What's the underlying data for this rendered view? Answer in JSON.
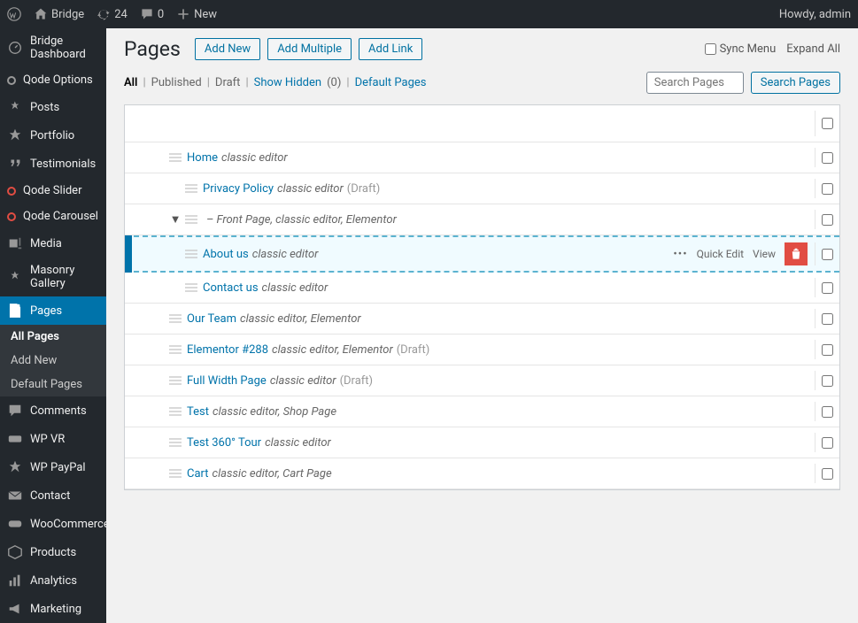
{
  "adminbar": {
    "site": "Bridge",
    "updates": "24",
    "comments": "0",
    "new": "New",
    "howdy": "Howdy, admin"
  },
  "sidebar": {
    "items": [
      {
        "label": "Bridge Dashboard",
        "icon": "dash"
      },
      {
        "label": "Qode Options",
        "icon": "qode"
      },
      {
        "label": "Posts",
        "icon": "pin"
      },
      {
        "label": "Portfolio",
        "icon": "star"
      },
      {
        "label": "Testimonials",
        "icon": "quote"
      },
      {
        "label": "Qode Slider",
        "icon": "qodered"
      },
      {
        "label": "Qode Carousel",
        "icon": "qodered"
      },
      {
        "label": "Media",
        "icon": "media"
      },
      {
        "label": "Masonry Gallery",
        "icon": "pin"
      },
      {
        "label": "Pages",
        "icon": "page",
        "active": true,
        "sub": [
          {
            "label": "All Pages",
            "active": true
          },
          {
            "label": "Add New"
          },
          {
            "label": "Default Pages"
          }
        ]
      },
      {
        "label": "Comments",
        "icon": "comment"
      },
      {
        "label": "WP VR",
        "icon": "vr"
      },
      {
        "label": "WP PayPal",
        "icon": "star"
      },
      {
        "label": "Contact",
        "icon": "mail"
      },
      {
        "label": "WooCommerce",
        "icon": "woo"
      },
      {
        "label": "Products",
        "icon": "box"
      },
      {
        "label": "Analytics",
        "icon": "chart"
      },
      {
        "label": "Marketing",
        "icon": "mega"
      }
    ]
  },
  "header": {
    "title": "Pages",
    "add_new": "Add New",
    "add_multiple": "Add Multiple",
    "add_link": "Add Link",
    "sync": "Sync Menu",
    "expand": "Expand All"
  },
  "filters": {
    "all": "All",
    "published": "Published",
    "draft": "Draft",
    "show_hidden": "Show Hidden",
    "show_hidden_count": "(0)",
    "default_pages": "Default Pages",
    "search_placeholder": "Search Pages",
    "search_btn": "Search Pages"
  },
  "actions": {
    "quick_edit": "Quick Edit",
    "view": "View",
    "more": "•••"
  },
  "rows": [
    {
      "indent": 1,
      "title": "Home",
      "meta": "classic editor"
    },
    {
      "indent": 2,
      "title": "Privacy Policy",
      "meta": "classic editor",
      "status": "(Draft)"
    },
    {
      "indent": 1,
      "prefix": "– ",
      "title": "Front Page",
      "meta": ", classic editor, Elementor",
      "plain": true,
      "caret": true
    },
    {
      "indent": 2,
      "title": "About us",
      "meta": "classic editor",
      "hover": true
    },
    {
      "indent": 2,
      "title": "Contact us",
      "meta": "classic editor"
    },
    {
      "indent": 1,
      "title": "Our Team",
      "meta": "classic editor, Elementor"
    },
    {
      "indent": 1,
      "title": "Elementor #288",
      "meta": "classic editor, Elementor",
      "status": "(Draft)"
    },
    {
      "indent": 1,
      "title": "Full Width Page",
      "meta": "classic editor",
      "status": "(Draft)"
    },
    {
      "indent": 1,
      "title": "Test",
      "meta": "classic editor, Shop Page"
    },
    {
      "indent": 1,
      "title": "Test 360° Tour",
      "meta": "classic editor"
    },
    {
      "indent": 1,
      "title": "Cart",
      "meta": "classic editor, Cart Page"
    }
  ]
}
